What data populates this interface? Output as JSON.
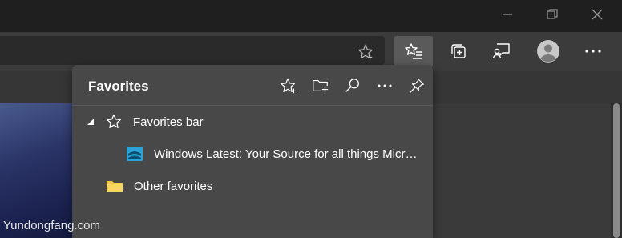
{
  "window": {
    "minimize_icon": "minimize-icon",
    "restore_icon": "restore-icon",
    "close_icon": "close-icon"
  },
  "toolbar": {
    "buttons": [
      "favorites-icon",
      "collections-icon",
      "feedback-icon",
      "profile-icon",
      "more-icon"
    ],
    "active": "favorites-icon"
  },
  "favorites_panel": {
    "title": "Favorites",
    "actions": [
      "add-favorite-icon",
      "add-folder-icon",
      "search-icon",
      "more-options-icon",
      "pin-icon"
    ],
    "items": [
      {
        "label": "Favorites bar",
        "icon": "star-icon",
        "expanded": true
      },
      {
        "label": "Windows Latest: Your Source for all things Microsoft",
        "icon": "site-favicon"
      },
      {
        "label": "Other favorites",
        "icon": "folder-icon"
      }
    ]
  },
  "watermark": "Yundongfang.com",
  "colors": {
    "panel": "#484848",
    "titlebar": "#1f1f1f",
    "toolbar": "#3b3b3b",
    "folder": "#f2c744",
    "favicon": "#2aa3d6"
  }
}
